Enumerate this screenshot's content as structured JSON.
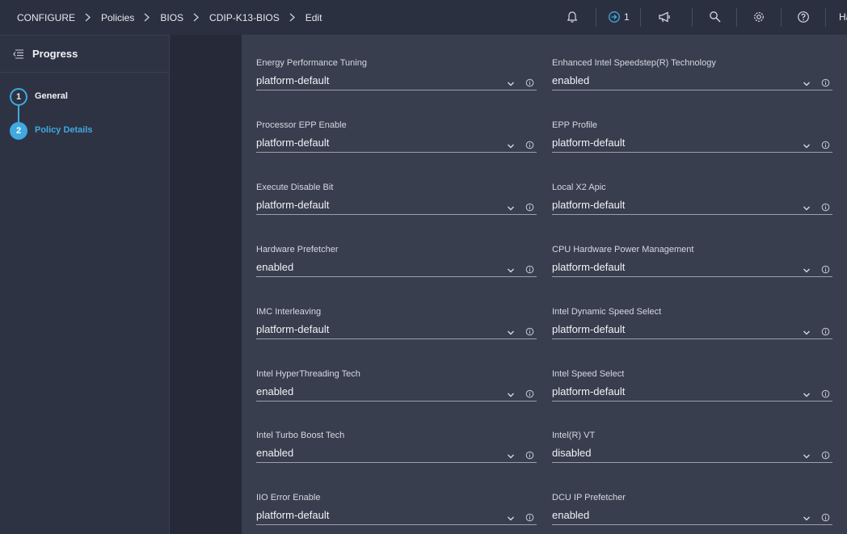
{
  "breadcrumb": [
    "CONFIGURE",
    "Policies",
    "BIOS",
    "CDIP-K13-BIOS",
    "Edit"
  ],
  "header": {
    "notification_count": "1",
    "user_initials": "Ha"
  },
  "progress": {
    "title": "Progress",
    "steps": [
      {
        "number": "1",
        "label": "General",
        "state": "completed"
      },
      {
        "number": "2",
        "label": "Policy Details",
        "state": "active"
      }
    ]
  },
  "fields": [
    {
      "label": "Energy Performance Tuning",
      "value": "platform-default"
    },
    {
      "label": "Enhanced Intel Speedstep(R) Technology",
      "value": "enabled"
    },
    {
      "label": "Processor EPP Enable",
      "value": "platform-default"
    },
    {
      "label": "EPP Profile",
      "value": "platform-default"
    },
    {
      "label": "Execute Disable Bit",
      "value": "platform-default"
    },
    {
      "label": "Local X2 Apic",
      "value": "platform-default"
    },
    {
      "label": "Hardware Prefetcher",
      "value": "enabled"
    },
    {
      "label": "CPU Hardware Power Management",
      "value": "platform-default"
    },
    {
      "label": "IMC Interleaving",
      "value": "platform-default"
    },
    {
      "label": "Intel Dynamic Speed Select",
      "value": "platform-default"
    },
    {
      "label": "Intel HyperThreading Tech",
      "value": "enabled"
    },
    {
      "label": "Intel Speed Select",
      "value": "platform-default"
    },
    {
      "label": "Intel Turbo Boost Tech",
      "value": "enabled"
    },
    {
      "label": "Intel(R) VT",
      "value": "disabled"
    },
    {
      "label": "IIO Error Enable",
      "value": "platform-default"
    },
    {
      "label": "DCU IP Prefetcher",
      "value": "enabled"
    }
  ],
  "icons": {
    "bell": "bell-icon",
    "requests": "arrow-in-circle-icon",
    "announcements": "megaphone-icon",
    "search": "search-icon",
    "settings": "gear-icon",
    "help": "question-circle-icon",
    "progress_toggle": "collapse-menu-icon"
  },
  "colors": {
    "accent": "#3fa9e0",
    "background": "#2b3040",
    "panel": "#383e4e"
  }
}
